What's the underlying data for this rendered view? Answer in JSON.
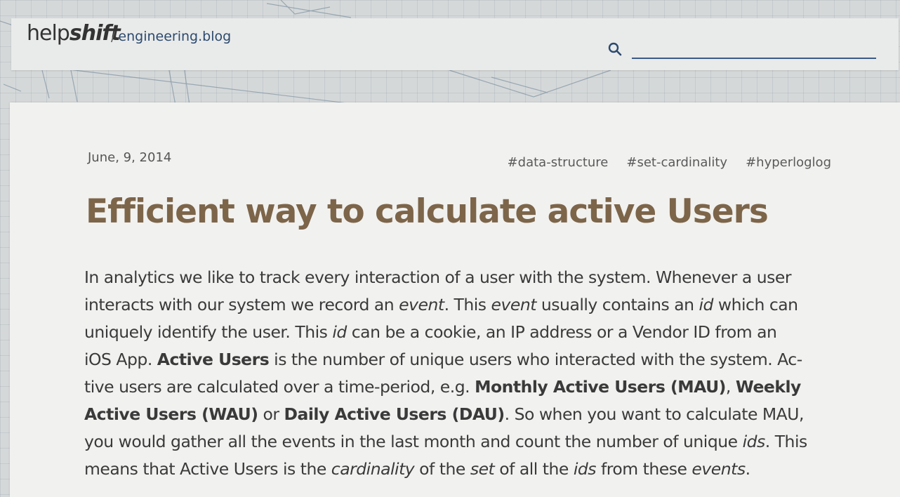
{
  "header": {
    "logo_light": "help",
    "logo_bold": "shift",
    "slash": "/",
    "blog_name": "engineering.blog",
    "search_value": ""
  },
  "post": {
    "date": "June, 9, 2014",
    "tags": [
      "#data-structure",
      "#set-cardinality",
      "#hyperloglog"
    ],
    "title": "Efficient way to calculate active Users",
    "paragraph_lines": [
      [
        {
          "t": "In analytics we like to track every interaction of a user with the system. Whenever a user",
          "s": ""
        }
      ],
      [
        {
          "t": "interacts with our system we record an ",
          "s": ""
        },
        {
          "t": "event",
          "s": "i"
        },
        {
          "t": ". This ",
          "s": ""
        },
        {
          "t": "event",
          "s": "i"
        },
        {
          "t": " usually contains an ",
          "s": ""
        },
        {
          "t": "id",
          "s": "i"
        },
        {
          "t": " which can",
          "s": ""
        }
      ],
      [
        {
          "t": "uniquely identify the user. This ",
          "s": ""
        },
        {
          "t": "id",
          "s": "i"
        },
        {
          "t": " can be a cookie, an IP address or a Vendor ID from an",
          "s": ""
        }
      ],
      [
        {
          "t": "iOS App. ",
          "s": ""
        },
        {
          "t": "Active Users",
          "s": "b"
        },
        {
          "t": " is the number of unique users who interacted with the system. Ac-",
          "s": ""
        }
      ],
      [
        {
          "t": "tive users are calculated over a time-period, e.g. ",
          "s": ""
        },
        {
          "t": "Monthly Active Users (MAU)",
          "s": "b"
        },
        {
          "t": ", ",
          "s": ""
        },
        {
          "t": "Weekly",
          "s": "b"
        }
      ],
      [
        {
          "t": "Active Users (WAU)",
          "s": "b"
        },
        {
          "t": " or ",
          "s": ""
        },
        {
          "t": "Daily Active Users (DAU)",
          "s": "b"
        },
        {
          "t": ". So when you want to calculate MAU,",
          "s": ""
        }
      ],
      [
        {
          "t": "you would gather all the events in the last month and count the number of unique ",
          "s": ""
        },
        {
          "t": "ids",
          "s": "i"
        },
        {
          "t": ". This",
          "s": ""
        }
      ],
      [
        {
          "t": "means that Active Users is the ",
          "s": ""
        },
        {
          "t": "cardinality",
          "s": "i"
        },
        {
          "t": " of the ",
          "s": ""
        },
        {
          "t": "set",
          "s": "i"
        },
        {
          "t": " of all the ",
          "s": ""
        },
        {
          "t": "ids",
          "s": "i"
        },
        {
          "t": " from these ",
          "s": ""
        },
        {
          "t": "events",
          "s": "i"
        },
        {
          "t": ".",
          "s": ""
        }
      ]
    ]
  },
  "colors": {
    "title": "#7d654a",
    "link": "#2c4a6e",
    "search_underline": "#3a5a88"
  },
  "icons": {
    "search": "search-icon"
  }
}
